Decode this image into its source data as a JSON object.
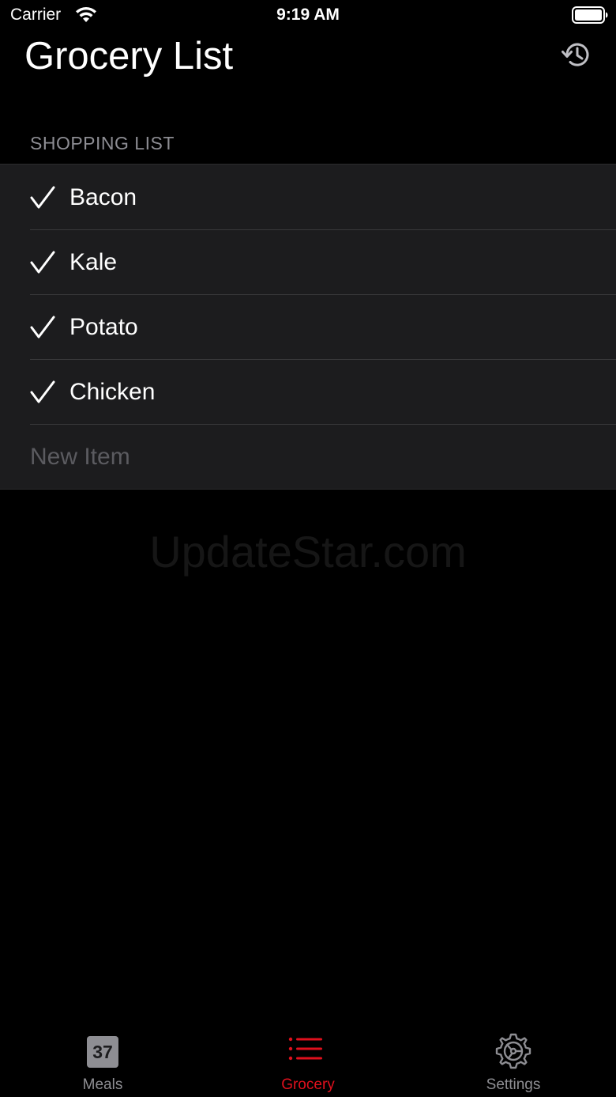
{
  "status_bar": {
    "carrier": "Carrier",
    "time": "9:19 AM",
    "wifi_icon": "wifi-icon",
    "battery_icon": "battery-full-icon"
  },
  "header": {
    "title": "Grocery List",
    "history_icon": "history-icon"
  },
  "shopping_list": {
    "section_title": "SHOPPING LIST",
    "items": [
      {
        "label": "Bacon",
        "checked": true
      },
      {
        "label": "Kale",
        "checked": true
      },
      {
        "label": "Potato",
        "checked": true
      },
      {
        "label": "Chicken",
        "checked": true
      }
    ],
    "new_item_placeholder": "New Item"
  },
  "watermark": "UpdateStar.com",
  "tab_bar": {
    "tabs": [
      {
        "label": "Meals",
        "icon": "calendar-icon",
        "badge": "37",
        "active": false
      },
      {
        "label": "Grocery",
        "icon": "list-icon",
        "active": true
      },
      {
        "label": "Settings",
        "icon": "gear-icon",
        "active": false
      }
    ]
  },
  "colors": {
    "accent": "#e0101d",
    "inactive": "#8e8e93",
    "background": "#000000",
    "list_background": "#1c1c1e",
    "section_header": "#8d8d93",
    "placeholder": "#5b5b60"
  }
}
